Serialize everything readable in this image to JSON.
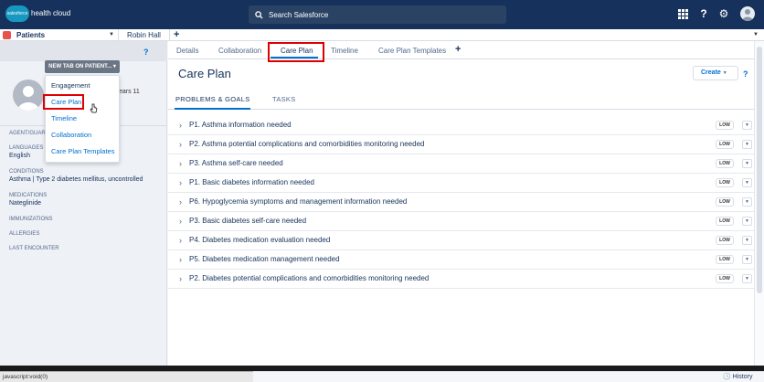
{
  "header": {
    "logo_text": "salesforce",
    "app_name": "health cloud",
    "search_placeholder": "Search Salesforce",
    "icons": [
      "app-launcher-icon",
      "help-icon",
      "setup-gear-icon",
      "user-avatar-icon"
    ]
  },
  "tabs": {
    "object": "Patients",
    "record_tab": "Robin Hall",
    "add": "+"
  },
  "left_panel": {
    "help": "?",
    "age_fragment": "ears 11",
    "dropdown": {
      "button_label": "NEW TAB ON PATIENT...",
      "items": [
        "Engagement",
        "Care Plan",
        "Timeline",
        "Collaboration",
        "Care Plan Templates"
      ]
    },
    "fields": [
      {
        "label": "AGENT/GUAR",
        "value": ""
      },
      {
        "label": "LANGUAGES",
        "value": "English"
      },
      {
        "label": "CONDITIONS",
        "value": "Asthma | Type 2 diabetes mellitus, uncontrolled"
      },
      {
        "label": "MEDICATIONS",
        "value": "Nateglinide"
      },
      {
        "label": "IMMUNIZATIONS",
        "value": ""
      },
      {
        "label": "ALLERGIES",
        "value": ""
      },
      {
        "label": "LAST ENCOUNTER",
        "value": ""
      }
    ]
  },
  "main": {
    "subtabs": [
      "Details",
      "Collaboration",
      "Care Plan",
      "Timeline",
      "Care Plan Templates"
    ],
    "active_subtab": "Care Plan",
    "add_subtab": "+",
    "title": "Care Plan",
    "create_label": "Create",
    "help": "?",
    "inner_tabs": [
      "PROBLEMS & GOALS",
      "TASKS"
    ],
    "problems": [
      {
        "title": "P1. Asthma information needed",
        "priority": "LOW"
      },
      {
        "title": "P2. Asthma potential complications and comorbidities monitoring needed",
        "priority": "LOW"
      },
      {
        "title": "P3. Asthma self-care needed",
        "priority": "LOW"
      },
      {
        "title": "P1. Basic diabetes information needed",
        "priority": "LOW"
      },
      {
        "title": "P6. Hypoglycemia symptoms and management information needed",
        "priority": "LOW"
      },
      {
        "title": "P3. Basic diabetes self-care needed",
        "priority": "LOW"
      },
      {
        "title": "P4. Diabetes medication evaluation needed",
        "priority": "LOW"
      },
      {
        "title": "P5. Diabetes medication management needed",
        "priority": "LOW"
      },
      {
        "title": "P2. Diabetes potential complications and comorbidities monitoring needed",
        "priority": "LOW"
      }
    ]
  },
  "status_bar": {
    "url": "javascript:void(0)",
    "history_label": "History"
  },
  "colors": {
    "header_bg": "#16325c",
    "link": "#0070d2",
    "highlight_box": "#e00000"
  }
}
